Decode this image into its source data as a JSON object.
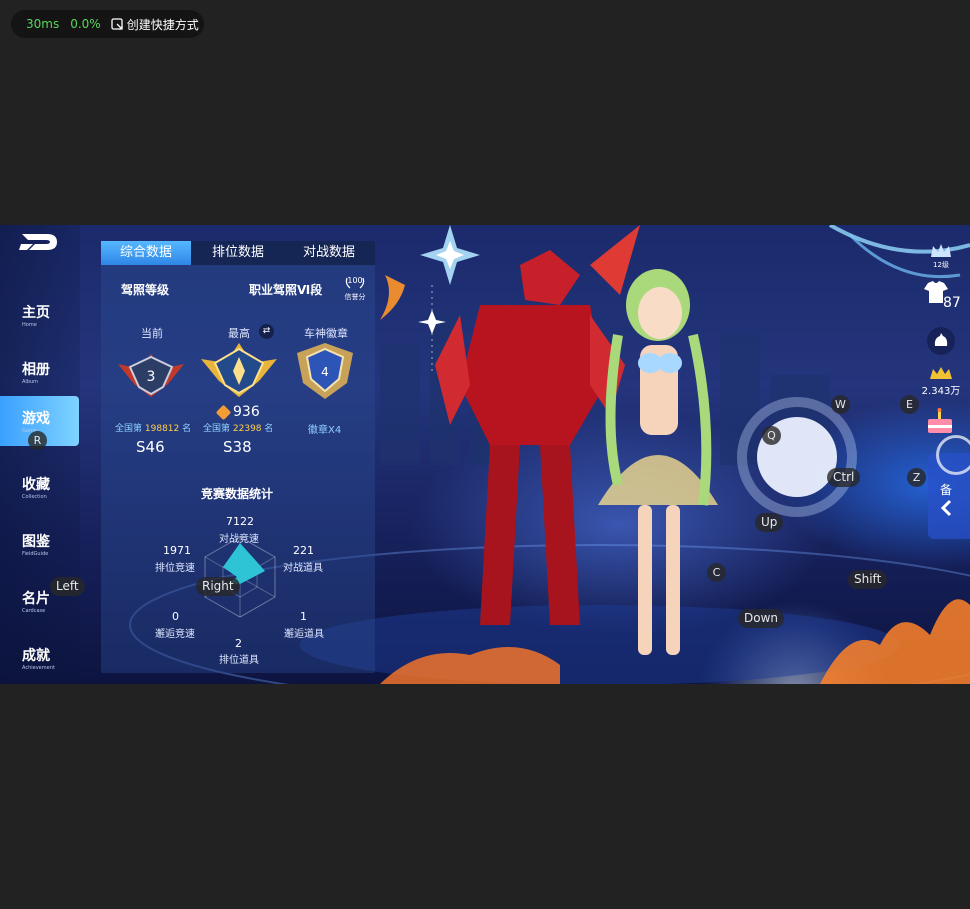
{
  "toolbar": {
    "latency": "30ms",
    "loss": "0.0%",
    "shortcut_label": "创建快捷方式"
  },
  "nav": {
    "items": [
      {
        "label": "主页",
        "sub": "Home"
      },
      {
        "label": "相册",
        "sub": "Album"
      },
      {
        "label": "游戏",
        "sub": "Game"
      },
      {
        "label": "收藏",
        "sub": "Collection"
      },
      {
        "label": "图鉴",
        "sub": "FieldGuide"
      },
      {
        "label": "名片",
        "sub": "Cardcase"
      },
      {
        "label": "成就",
        "sub": "Achievement"
      }
    ]
  },
  "panel": {
    "tabs": [
      "综合数据",
      "排位数据",
      "对战数据"
    ],
    "license_title": "驾照等级",
    "license_level": "职业驾照Ⅵ段",
    "credit_score": "100",
    "credit_label": "信誉分",
    "col_current": "当前",
    "col_highest": "最高",
    "col_badge": "车神徽章",
    "highest_points": "936",
    "rank_current_prefix": "全国第",
    "rank_current_num": "198812",
    "rank_current_suffix": "名",
    "rank_high_prefix": "全国第",
    "rank_high_num": "22398",
    "rank_high_suffix": "名",
    "badge_count": "徽章X4",
    "season_current": "S46",
    "season_highest": "S38",
    "stats_title": "竞赛数据统计",
    "stats": {
      "battle_speed": {
        "value": "7122",
        "label": "对战竞速"
      },
      "rank_speed": {
        "value": "1971",
        "label": "排位竞速"
      },
      "battle_item": {
        "value": "221",
        "label": "对战道具"
      },
      "casual_speed": {
        "value": "0",
        "label": "邂逅竞速"
      },
      "casual_item": {
        "value": "1",
        "label": "邂逅道具"
      },
      "rank_item": {
        "value": "2",
        "label": "排位道具"
      }
    }
  },
  "right": {
    "level_top": "12级",
    "level_num": "87",
    "coins": "2.343万",
    "side_text": "备"
  },
  "keys": {
    "r": "R",
    "left": "Left",
    "right": "Right",
    "w": "W",
    "e": "E",
    "q": "Q",
    "ctrl": "Ctrl",
    "z": "Z",
    "up": "Up",
    "c": "C",
    "shift": "Shift",
    "down": "Down"
  },
  "colors": {
    "accent": "#3aa0ff",
    "gold": "#ffcf4a",
    "green": "#56d85b"
  }
}
